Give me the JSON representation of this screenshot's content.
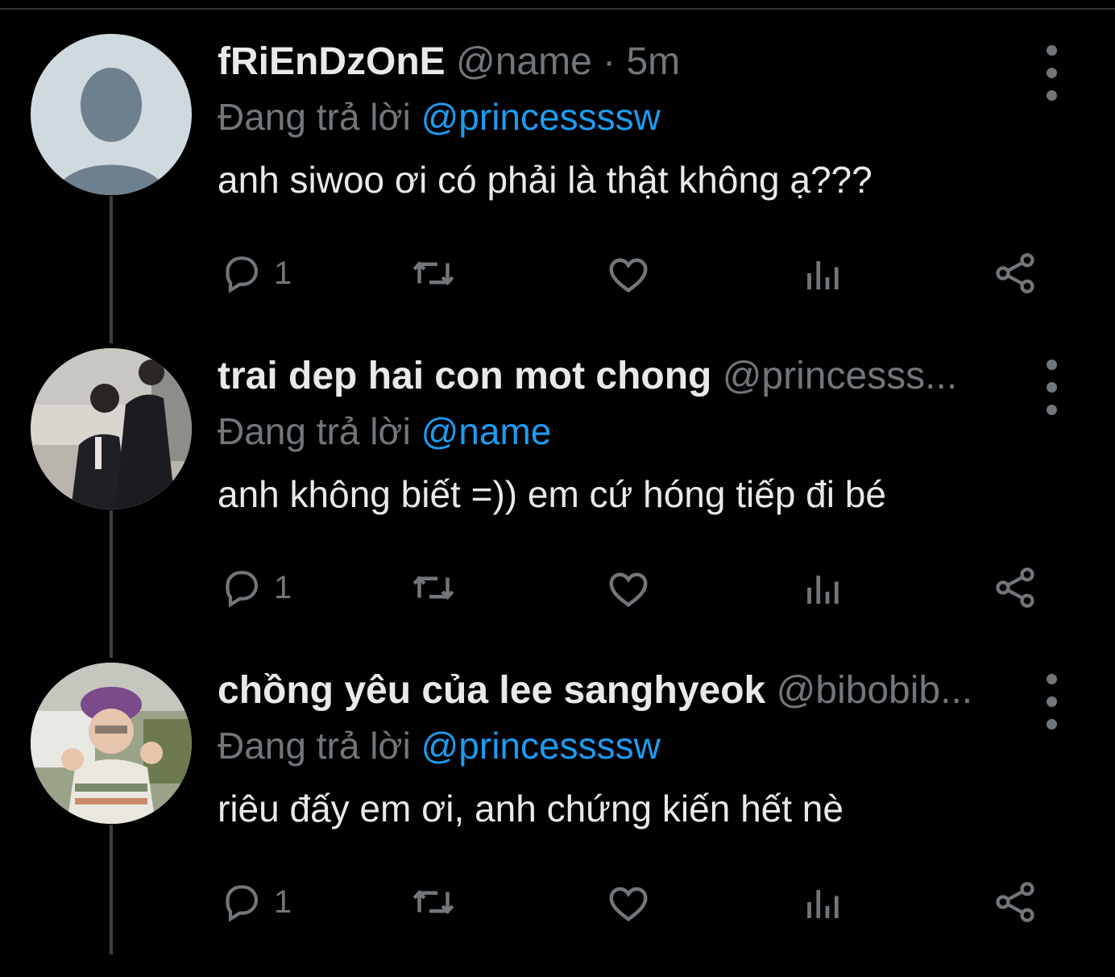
{
  "tweets": [
    {
      "display_name": "fRiEnDzOnE",
      "handle": "@name · 5m",
      "replying_prefix": "Đang trả lời",
      "replying_to": "@princessssw",
      "text": "anh siwoo ơi có phải là thật không ạ???",
      "reply_count": "1",
      "avatar": "default-avatar"
    },
    {
      "display_name": "trai dep hai con mot chong",
      "handle": "@princesss...",
      "replying_prefix": "Đang trả lời",
      "replying_to": "@name",
      "text": "anh không biết =)) em cứ hóng tiếp đi bé",
      "reply_count": "1",
      "avatar": "photo-avatar"
    },
    {
      "display_name": "chồng yêu của lee sanghyeok",
      "handle": "@bibobib...",
      "replying_prefix": "Đang trả lời",
      "replying_to": "@princessssw",
      "text": "riêu đấy em ơi, anh chứng kiến hết nè",
      "reply_count": "1",
      "avatar": "photo-avatar"
    }
  ],
  "colors": {
    "background": "#000000",
    "text": "#e7e9ea",
    "muted": "#71767b",
    "mention": "#1d9bf0",
    "thread_line": "#3b4046"
  },
  "icons": [
    "reply-icon",
    "retweet-icon",
    "like-icon",
    "views-icon",
    "share-icon",
    "more-icon"
  ]
}
